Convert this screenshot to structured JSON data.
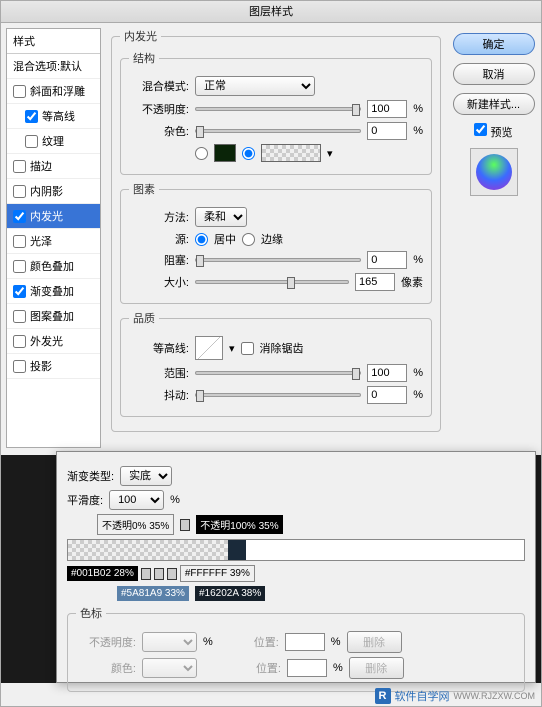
{
  "title": "图层样式",
  "sidebar": {
    "header": "样式",
    "blend_options": "混合选项:默认",
    "items": [
      {
        "label": "斜面和浮雕",
        "checked": false
      },
      {
        "label": "等高线",
        "checked": true,
        "indent": true
      },
      {
        "label": "纹理",
        "checked": false,
        "indent": true
      },
      {
        "label": "描边",
        "checked": false
      },
      {
        "label": "内阴影",
        "checked": false
      },
      {
        "label": "内发光",
        "checked": true,
        "active": true
      },
      {
        "label": "光泽",
        "checked": false
      },
      {
        "label": "颜色叠加",
        "checked": false
      },
      {
        "label": "渐变叠加",
        "checked": true
      },
      {
        "label": "图案叠加",
        "checked": false
      },
      {
        "label": "外发光",
        "checked": false
      },
      {
        "label": "投影",
        "checked": false
      }
    ]
  },
  "panel_title": "内发光",
  "structure": {
    "legend": "结构",
    "blend_mode_label": "混合模式:",
    "blend_mode_value": "正常",
    "opacity_label": "不透明度:",
    "opacity_value": "100",
    "noise_label": "杂色:",
    "noise_value": "0",
    "percent": "%"
  },
  "elements": {
    "legend": "图素",
    "technique_label": "方法:",
    "technique_value": "柔和",
    "source_label": "源:",
    "source_center": "居中",
    "source_edge": "边缘",
    "choke_label": "阻塞:",
    "choke_value": "0",
    "size_label": "大小:",
    "size_value": "165",
    "size_unit": "像素",
    "percent": "%"
  },
  "quality": {
    "legend": "品质",
    "contour_label": "等高线:",
    "antialias_label": "消除锯齿",
    "range_label": "范围:",
    "range_value": "100",
    "jitter_label": "抖动:",
    "jitter_value": "0",
    "percent": "%"
  },
  "buttons": {
    "ok": "确定",
    "cancel": "取消",
    "new_style": "新建样式...",
    "preview": "预览"
  },
  "gradient": {
    "type_label": "渐变类型:",
    "type_value": "实底",
    "smoothness_label": "平滑度:",
    "smoothness_value": "100",
    "percent": "%",
    "opacity_stop_left": "不透明0% 35%",
    "opacity_stop_right": "不透明100% 35%",
    "color_tag1": "#001B02 28%",
    "color_tag2": "#FFFFFF 39%",
    "color_tag3": "#5A81A9 33%",
    "color_tag4": "#16202A 38%",
    "stops_legend": "色标",
    "opacity_label": "不透明度:",
    "position_label": "位置:",
    "color_label": "颜色:",
    "delete": "删除"
  },
  "footer": {
    "brand": "软件自学网",
    "url": "WWW.RJZXW.COM"
  }
}
